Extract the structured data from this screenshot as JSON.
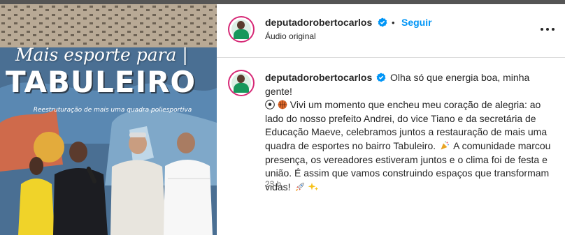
{
  "post": {
    "username": "deputadorobertocarlos",
    "follow_label": "Seguir",
    "separator": "•",
    "audio_label": "Áudio original",
    "caption_username": "deputadorobertocarlos",
    "caption_lines": [
      "Olha só que energia boa, minha gente!",
      "Vivi um momento que encheu meu coração de alegria: ao",
      "lado do nosso prefeito Andrei, do vice Tiano e da secretária de",
      "Educação Maeve, celebramos juntos a restauração de mais uma",
      "quadra de esportes no bairro Tabuleiro.",
      "A comunidade marcou",
      "presença, os vereadores estiveram juntos e o clima foi de festa e",
      "união. É assim que vamos construindo espaços que transformam",
      "vidas!"
    ],
    "time_ago": "23 h",
    "icons": [
      "verified-badge-icon",
      "soccer-ball-icon",
      "basketball-icon",
      "party-popper-icon",
      "rocket-icon",
      "sparkles-icon",
      "more-options-icon"
    ],
    "colors": {
      "follow": "#0095f6",
      "verified": "#0095f6",
      "story_ring": "#d62976",
      "muted_text": "#737373"
    }
  },
  "video": {
    "title_script": "Mais esporte para |",
    "title_big": "TABULEIRO",
    "subtitle": "Reestruturação de mais uma quadra poliesportiva"
  }
}
